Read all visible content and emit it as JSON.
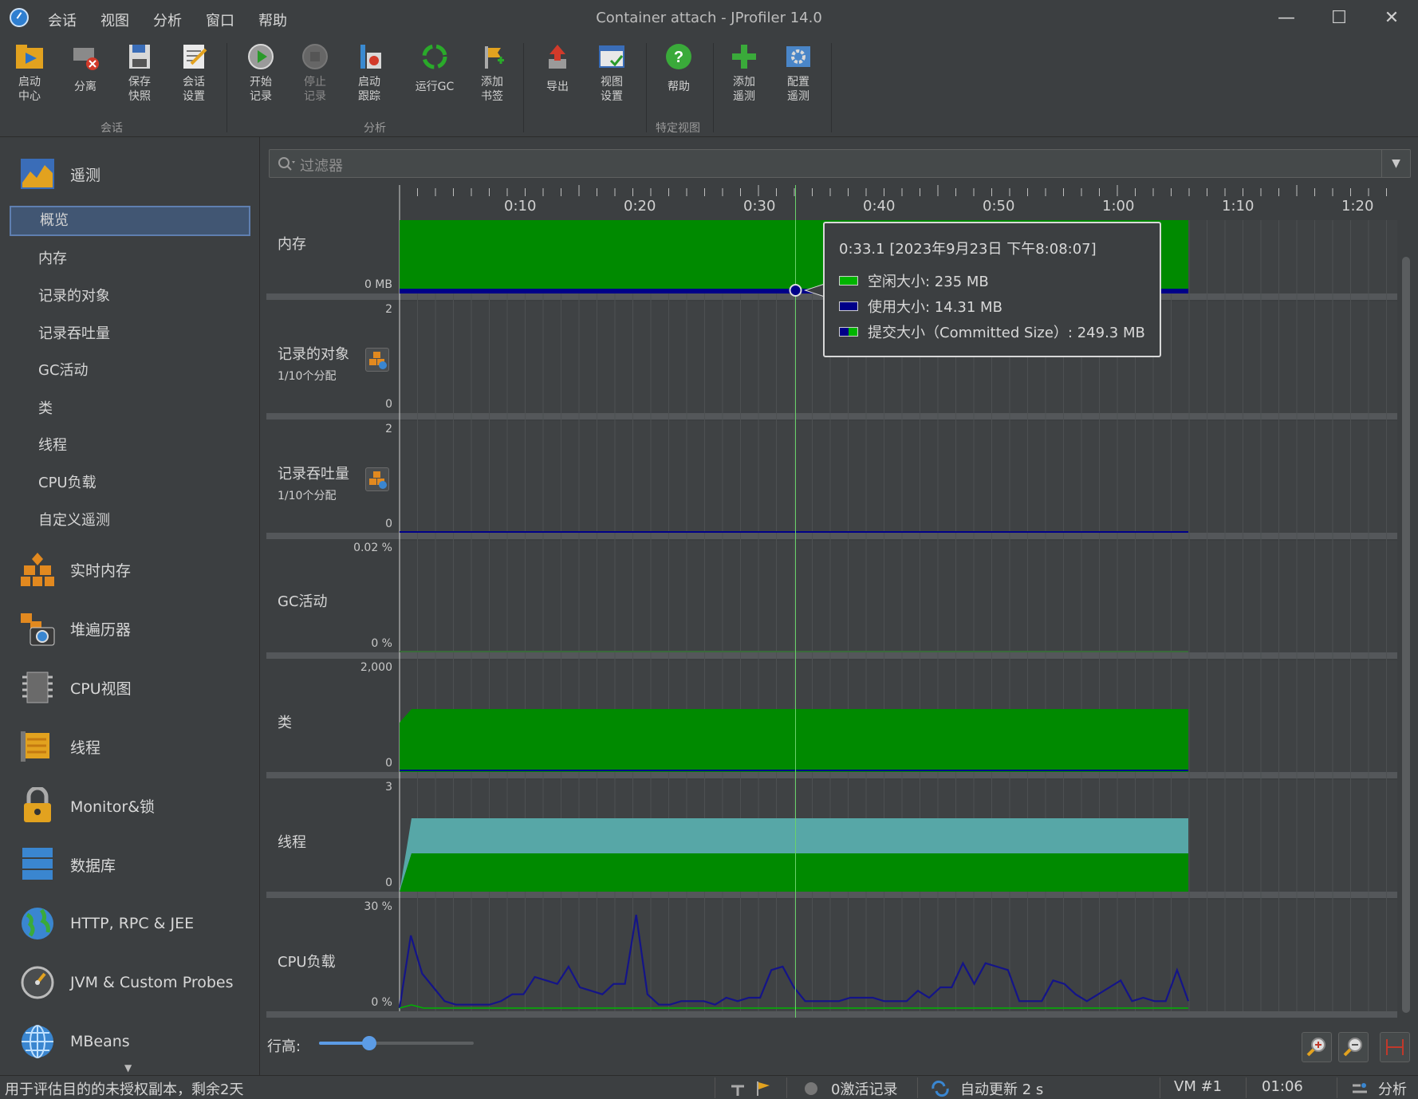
{
  "window": {
    "title": "Container attach - JProfiler 14.0",
    "menu": [
      "会话",
      "视图",
      "分析",
      "窗口",
      "帮助"
    ],
    "controls": {
      "minimize": "—",
      "maximize": "☐",
      "close": "✕"
    }
  },
  "toolbar": {
    "buttons": [
      {
        "label": "启动\n中心",
        "icon": "launch-center-icon"
      },
      {
        "label": "分离",
        "icon": "detach-icon"
      },
      {
        "label": "保存\n快照",
        "icon": "save-snapshot-icon"
      },
      {
        "label": "会话\n设置",
        "icon": "session-settings-icon"
      },
      {
        "label": "开始\n记录",
        "icon": "start-recording-icon"
      },
      {
        "label": "停止\n记录",
        "icon": "stop-recording-icon",
        "disabled": true
      },
      {
        "label": "启动\n跟踪",
        "icon": "start-tracking-icon"
      },
      {
        "label": "运行GC",
        "icon": "run-gc-icon"
      },
      {
        "label": "添加\n书签",
        "icon": "add-bookmark-icon"
      },
      {
        "label": "导出",
        "icon": "export-icon"
      },
      {
        "label": "视图\n设置",
        "icon": "view-settings-icon"
      },
      {
        "label": "帮助",
        "icon": "help-icon"
      },
      {
        "label": "添加\n遥测",
        "icon": "add-telemetry-icon"
      },
      {
        "label": "配置\n遥测",
        "icon": "configure-telemetry-icon"
      }
    ],
    "groups": [
      "会话",
      "分析",
      "特定视图"
    ]
  },
  "sidebar": {
    "telemetry": {
      "label": "遥测",
      "items": [
        "概览",
        "内存",
        "记录的对象",
        "记录吞吐量",
        "GC活动",
        "类",
        "线程",
        "CPU负载",
        "自定义遥测"
      ],
      "selected": "概览"
    },
    "sections": [
      "实时内存",
      "堆遍历器",
      "CPU视图",
      "线程",
      "Monitor&锁",
      "数据库",
      "HTTP, RPC & JEE",
      "JVM & Custom Probes",
      "MBeans"
    ]
  },
  "filter": {
    "placeholder": "过滤器"
  },
  "timeline": {
    "ticks": [
      "0:10",
      "0:20",
      "0:30",
      "0:40",
      "0:50",
      "1:00",
      "1:10",
      "1:20"
    ]
  },
  "rows": {
    "memory": {
      "label": "内存",
      "y_min": "0 MB"
    },
    "recorded_objects": {
      "label": "记录的对象",
      "sub": "1/10个分配",
      "y_max": "2",
      "y_min": "0"
    },
    "recorded_throughput": {
      "label": "记录吞吐量",
      "sub": "1/10个分配",
      "y_max": "2",
      "y_min": "0"
    },
    "gc": {
      "label": "GC活动",
      "y_max": "0.02 %",
      "y_min": "0 %"
    },
    "classes": {
      "label": "类",
      "y_max": "2,000",
      "y_min": "0"
    },
    "threads": {
      "label": "线程",
      "y_max": "3",
      "y_min": "0"
    },
    "cpu": {
      "label": "CPU负载",
      "y_max": "30 %",
      "y_min": "0 %"
    }
  },
  "tooltip": {
    "time": "0:33.1 [2023年9月23日 下午8:08:07]",
    "free": "空闲大小:  235 MB",
    "used": "使用大小:  14.31 MB",
    "committed": "提交大小（Committed Size）:  249.3 MB"
  },
  "colors": {
    "free": "#008a00",
    "used": "#000088",
    "threads_runnable": "#57a7a7",
    "cpu": "#141488"
  },
  "chart_data": {
    "type": "line",
    "title": "CPU负载",
    "ylabel": "",
    "ylim": [
      0,
      30
    ],
    "x_seconds": [
      0,
      1,
      2,
      3,
      4,
      5,
      6,
      7,
      8,
      9,
      10,
      11,
      12,
      13,
      14,
      15,
      16,
      17,
      18,
      19,
      20,
      21,
      22,
      23,
      24,
      25,
      26,
      27,
      28,
      29,
      30,
      31,
      32,
      33,
      34,
      35,
      36,
      37,
      38,
      39,
      40,
      41,
      42,
      43,
      44,
      45,
      46,
      47,
      48,
      49,
      50,
      51,
      52,
      53,
      54,
      55,
      56,
      57,
      58,
      59,
      60,
      61,
      62,
      63,
      64,
      65,
      66
    ],
    "series": [
      {
        "values": [
          0,
          21,
          10,
          6,
          2,
          1,
          1,
          1,
          1,
          2,
          4,
          4,
          9,
          8,
          7,
          12,
          6,
          5,
          4,
          7,
          7,
          27,
          4,
          1,
          1,
          2,
          2,
          2,
          1,
          3,
          2,
          3,
          3,
          11,
          12,
          6,
          2,
          2,
          2,
          2,
          3,
          3,
          3,
          2,
          2,
          2,
          5,
          3,
          6,
          6,
          13,
          7,
          13,
          12,
          11,
          2,
          2,
          2,
          8,
          7,
          4,
          2,
          4,
          6,
          8,
          2,
          3,
          2,
          2,
          11,
          2
        ]
      }
    ]
  },
  "row_height": {
    "label": "行高:"
  },
  "status": {
    "license": "用于评估目的的未授权副本，剩余2天",
    "recordings": "0激活记录",
    "auto_update": "自动更新 2 s",
    "vm": "VM #1",
    "time": "01:06",
    "analysis": "分析"
  }
}
